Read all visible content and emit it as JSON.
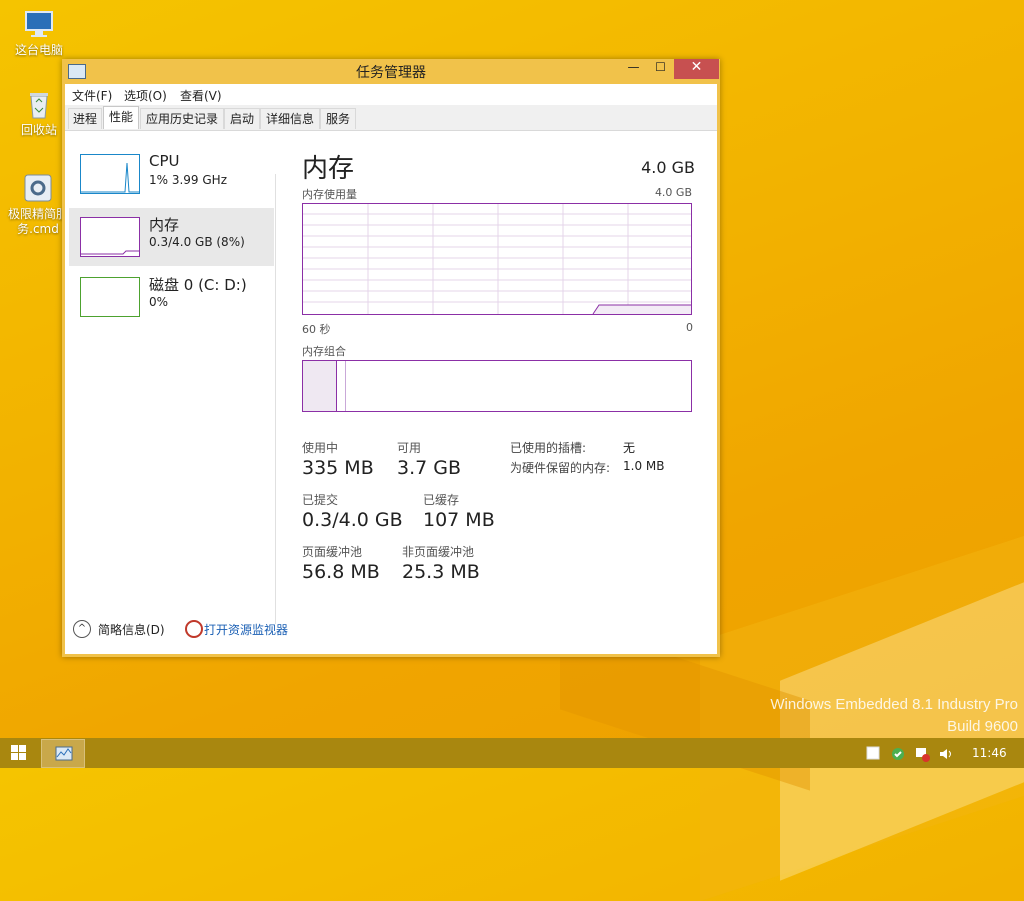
{
  "desktop": {
    "icons": [
      {
        "name": "这台电脑"
      },
      {
        "name": "回收站"
      },
      {
        "name": "极限精简服务.cmd",
        "line1": "极限精简服",
        "line2": "务.cmd"
      }
    ],
    "watermark": {
      "line1": "Windows Embedded 8.1 Industry Pro",
      "line2": "Build 9600"
    }
  },
  "window": {
    "title": "任务管理器",
    "controls": {
      "minimize": "—",
      "maximize": "☐",
      "close": "✕"
    },
    "menu": {
      "file": "文件(F)",
      "options": "选项(O)",
      "view": "查看(V)"
    },
    "tabs": [
      {
        "label": "进程"
      },
      {
        "label": "性能"
      },
      {
        "label": "应用历史记录"
      },
      {
        "label": "启动"
      },
      {
        "label": "详细信息"
      },
      {
        "label": "服务"
      }
    ],
    "active_tab": "性能"
  },
  "resources": [
    {
      "title": "CPU",
      "sub": "1%  3.99 GHz",
      "color": "#1a87c9"
    },
    {
      "title": "内存",
      "sub": "0.3/4.0 GB (8%)",
      "color": "#8b2fa6"
    },
    {
      "title": "磁盘 0 (C: D:)",
      "sub": "0%",
      "color": "#4da22f"
    }
  ],
  "detail": {
    "title": "内存",
    "total": "4.0 GB",
    "usage_label": "内存使用量",
    "usage_max": "4.0 GB",
    "time_left": "60 秒",
    "time_right": "0",
    "composition_label": "内存组合",
    "stats": {
      "in_use_label": "使用中",
      "in_use": "335 MB",
      "available_label": "可用",
      "available": "3.7 GB",
      "committed_label": "已提交",
      "committed": "0.3/4.0 GB",
      "cached_label": "已缓存",
      "cached": "107 MB",
      "paged_label": "页面缓冲池",
      "paged": "56.8 MB",
      "nonpaged_label": "非页面缓冲池",
      "nonpaged": "25.3 MB"
    },
    "kv": {
      "slots_label": "已使用的插槽:",
      "slots": "无",
      "reserved_label": "为硬件保留的内存:",
      "reserved": "1.0 MB"
    },
    "accent": "#8b2fa6"
  },
  "footer": {
    "fewer_details": "简略信息(D)",
    "open_monitor": "打开资源监视器"
  },
  "taskbar": {
    "clock": "11:46",
    "accent": "#a9870f"
  }
}
